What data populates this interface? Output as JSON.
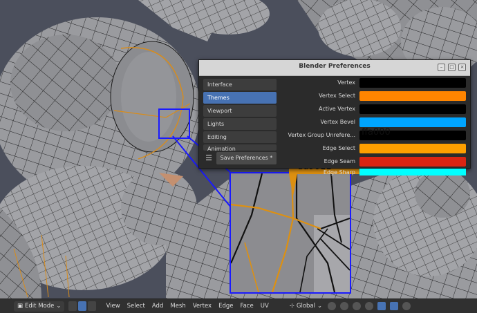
{
  "window": {
    "title": "Blender Preferences"
  },
  "nav": {
    "items": [
      {
        "label": "Interface"
      },
      {
        "label": "Themes",
        "active": true
      },
      {
        "label": "Viewport"
      },
      {
        "label": "Lights"
      },
      {
        "label": "Editing"
      },
      {
        "label": "Animation"
      }
    ],
    "menu_icon": "hamburger-icon",
    "save_label": "Save Preferences *"
  },
  "theme_rows": [
    {
      "label": "Vertex",
      "color": "#000000"
    },
    {
      "label": "Vertex Select",
      "color": "#ff8500"
    },
    {
      "label": "Active Vertex",
      "color": "#000000"
    },
    {
      "label": "Vertex Bevel",
      "color": "#00a5ff"
    },
    {
      "label": "Vertex Group Unrefere...",
      "color": "#000000"
    },
    {
      "label": "Edge Select",
      "color": "#ffa000"
    },
    {
      "label": "Edge Seam",
      "color": "#db2512"
    },
    {
      "label": "Edge Sharp",
      "color": "#00ffff"
    }
  ],
  "annotations": {
    "edge_select_hex": "ffa000",
    "zoom_hex": "dd9011",
    "zoom_color": "#dd9011",
    "box_color": "#1a1aff"
  },
  "toolbar": {
    "mode": "Edit Mode",
    "menus": [
      "View",
      "Select",
      "Add",
      "Mesh",
      "Vertex",
      "Edge",
      "Face",
      "UV"
    ],
    "orientation": "Global"
  }
}
